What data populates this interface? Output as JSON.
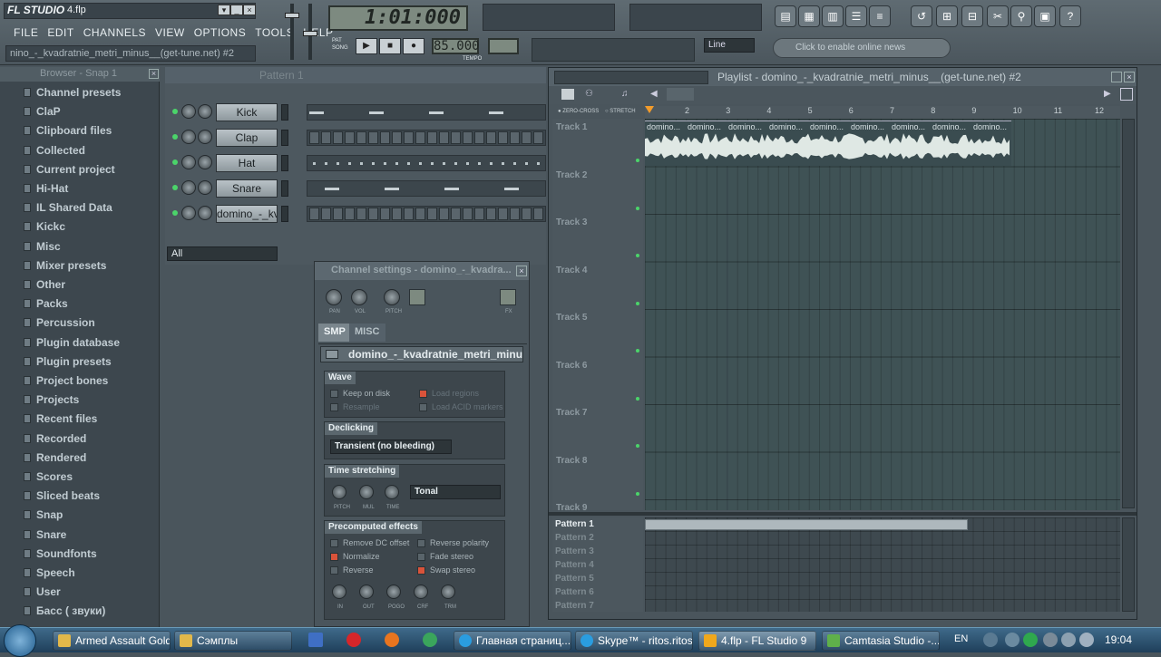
{
  "app": {
    "logo": "FL STUDIO",
    "file_name": "4.flp",
    "hint_text": "nino_-_kvadratnie_metri_minus__(get-tune.net) #2"
  },
  "menu": [
    "FILE",
    "EDIT",
    "CHANNELS",
    "VIEW",
    "OPTIONS",
    "TOOLS",
    "HELP"
  ],
  "transport": {
    "time": "1:01:000",
    "tempo": "85.000",
    "pat_label": "PAT",
    "song_label": "SONG",
    "snap": "Line",
    "tempo_label": "TEMPO"
  },
  "news": {
    "text": "Click to enable online news"
  },
  "browser": {
    "title": "Browser - Snap 1",
    "items": [
      "Channel presets",
      "ClaP",
      "Clipboard files",
      "Collected",
      "Current project",
      "Hi-Hat",
      "IL Shared Data",
      "Kickc",
      "Misc",
      "Mixer presets",
      "Other",
      "Packs",
      "Percussion",
      "Plugin database",
      "Plugin presets",
      "Project bones",
      "Projects",
      "Recent files",
      "Recorded",
      "Rendered",
      "Scores",
      "Sliced beats",
      "Snap",
      "Snare",
      "Soundfonts",
      "Speech",
      "User",
      "Басс ( звуки)"
    ]
  },
  "channel_rack": {
    "pattern_label": "Pattern 1",
    "filter": "All",
    "channels": [
      "Kick",
      "Clap",
      "Hat",
      "Snare",
      "domino_-_kva..."
    ]
  },
  "channel_settings": {
    "title": "Channel settings - domino_-_kvadra...",
    "tabs": [
      "SMP",
      "MISC"
    ],
    "knob_labels": [
      "PAN",
      "VOL",
      "PITCH",
      "FX"
    ],
    "sample_name": "domino_-_kvadratnie_metri_minus...",
    "wave": {
      "title": "Wave",
      "options": [
        "Keep on disk",
        "Load regions",
        "Resample",
        "Load ACID markers"
      ]
    },
    "declicking": {
      "title": "Declicking",
      "value": "Transient (no bleeding)"
    },
    "time_stretching": {
      "title": "Time stretching",
      "value": "Tonal",
      "knob_labels": [
        "PITCH",
        "MUL",
        "TIME"
      ]
    },
    "precomputed": {
      "title": "Precomputed effects",
      "options": [
        "Remove DC offset",
        "Reverse polarity",
        "Normalize",
        "Fade stereo",
        "Reverse",
        "Swap stereo"
      ],
      "knob_labels": [
        "IN",
        "OUT",
        "POGO",
        "CRF",
        "TRM"
      ]
    }
  },
  "playlist": {
    "title": "Playlist - domino_-_kvadratnie_metri_minus__(get-tune.net) #2",
    "toolbar": {
      "zero_cross": "ZERO-CROSS",
      "stretch": "STRETCH"
    },
    "ruler": [
      "2",
      "3",
      "4",
      "5",
      "6",
      "7",
      "8",
      "9",
      "10",
      "11",
      "12"
    ],
    "tracks": [
      "Track 1",
      "Track 2",
      "Track 3",
      "Track 4",
      "Track 5",
      "Track 6",
      "Track 7",
      "Track 8",
      "Track 9"
    ],
    "clip_label": "domino...",
    "patterns": [
      "Pattern 1",
      "Pattern 2",
      "Pattern 3",
      "Pattern 4",
      "Pattern 5",
      "Pattern 6",
      "Pattern 7"
    ]
  },
  "taskbar": {
    "tasks": [
      "Armed Assault Gold",
      "Сэмплы",
      "Главная страниц...",
      "Skype™ - ritos.ritos",
      "4.flp - FL Studio 9",
      "Camtasia Studio -..."
    ],
    "lang": "EN",
    "clock": "19:04"
  },
  "colors": {
    "accent_green": "#4bd46a",
    "active_red": "#d9533a",
    "waveform": "#dfe8e4"
  }
}
